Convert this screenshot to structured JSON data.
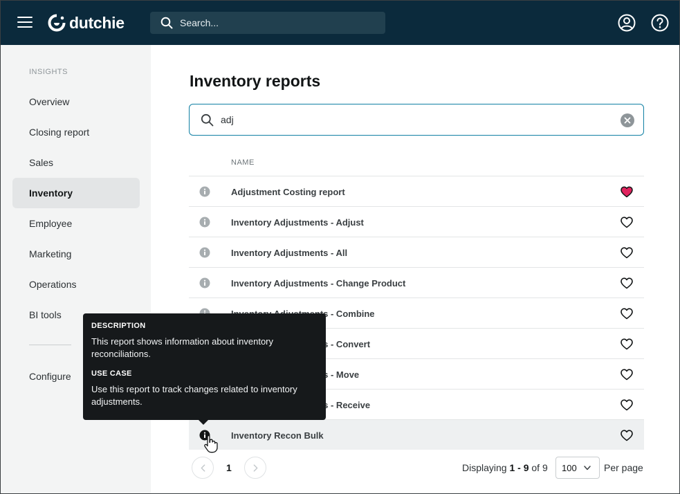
{
  "header": {
    "logo_text": "dutchie",
    "search_placeholder": "Search..."
  },
  "sidebar": {
    "heading": "INSIGHTS",
    "items": [
      {
        "label": "Overview"
      },
      {
        "label": "Closing report"
      },
      {
        "label": "Sales"
      },
      {
        "label": "Inventory",
        "active": true
      },
      {
        "label": "Employee"
      },
      {
        "label": "Marketing"
      },
      {
        "label": "Operations"
      },
      {
        "label": "BI tools"
      }
    ],
    "configure_label": "Configure"
  },
  "main": {
    "title": "Inventory reports",
    "search_value": "adj",
    "column_name": "NAME",
    "rows": [
      {
        "name": "Adjustment Costing report",
        "favorite": true
      },
      {
        "name": "Inventory Adjustments - Adjust",
        "favorite": false
      },
      {
        "name": "Inventory Adjustments - All",
        "favorite": false
      },
      {
        "name": "Inventory Adjustments - Change Product",
        "favorite": false
      },
      {
        "name": "Inventory Adjustments - Combine",
        "favorite": false
      },
      {
        "name": "Inventory Adjustments - Convert",
        "favorite": false
      },
      {
        "name": "Inventory Adjustments - Move",
        "favorite": false
      },
      {
        "name": "Inventory Adjustments - Receive",
        "favorite": false
      },
      {
        "name": "Inventory Recon Bulk",
        "favorite": false
      }
    ]
  },
  "pagination": {
    "current_page": "1",
    "displaying_prefix": "Displaying",
    "range": "1 - 9",
    "of_label": "of",
    "total": "9",
    "per_page_value": "100",
    "per_page_label": "Per page"
  },
  "tooltip": {
    "description_heading": "DESCRIPTION",
    "description_text": "This report shows information about inventory reconciliations.",
    "use_case_heading": "USE CASE",
    "use_case_text": "Use this report to track changes related to inventory adjustments."
  },
  "colors": {
    "header_bg": "#0b2a3c",
    "accent": "#0f7fa3",
    "favorite": "#e0245e"
  }
}
